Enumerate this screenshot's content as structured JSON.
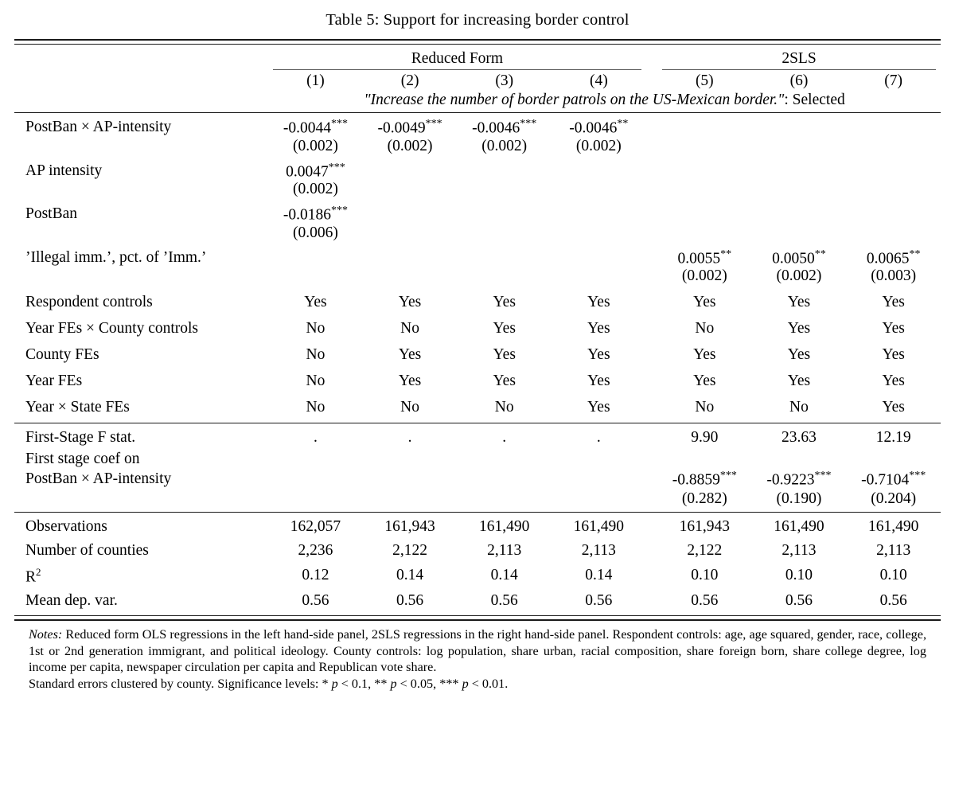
{
  "title": "Table 5: Support for increasing border control",
  "panels": [
    {
      "label": "Reduced Form",
      "span": 4
    },
    {
      "label": "2SLS",
      "span": 3
    }
  ],
  "column_numbers": [
    "(1)",
    "(2)",
    "(3)",
    "(4)",
    "(5)",
    "(6)",
    "(7)"
  ],
  "dep_var_line": {
    "italic_part": "\"Increase the number of border patrols on the US-Mexican border.\"",
    "roman_part": ": Selected"
  },
  "coef_blocks": [
    {
      "label": "PostBan × AP-intensity",
      "coefs": [
        "-0.0044",
        "-0.0049",
        "-0.0046",
        "-0.0046",
        "",
        "",
        ""
      ],
      "stars": [
        "***",
        "***",
        "***",
        "**",
        "",
        "",
        ""
      ],
      "ses": [
        "(0.002)",
        "(0.002)",
        "(0.002)",
        "(0.002)",
        "",
        "",
        ""
      ]
    },
    {
      "label": "AP intensity",
      "coefs": [
        "0.0047",
        "",
        "",
        "",
        "",
        "",
        ""
      ],
      "stars": [
        "***",
        "",
        "",
        "",
        "",
        "",
        ""
      ],
      "ses": [
        "(0.002)",
        "",
        "",
        "",
        "",
        "",
        ""
      ]
    },
    {
      "label": "PostBan",
      "coefs": [
        "-0.0186",
        "",
        "",
        "",
        "",
        "",
        ""
      ],
      "stars": [
        "***",
        "",
        "",
        "",
        "",
        "",
        ""
      ],
      "ses": [
        "(0.006)",
        "",
        "",
        "",
        "",
        "",
        ""
      ]
    },
    {
      "label": "’Illegal imm.’, pct. of ’Imm.’",
      "coefs": [
        "",
        "",
        "",
        "",
        "0.0055",
        "0.0050",
        "0.0065"
      ],
      "stars": [
        "",
        "",
        "",
        "",
        "**",
        "**",
        "**"
      ],
      "ses": [
        "",
        "",
        "",
        "",
        "(0.002)",
        "(0.002)",
        "(0.003)"
      ]
    }
  ],
  "yesno_rows": [
    {
      "label": "Respondent controls",
      "values": [
        "Yes",
        "Yes",
        "Yes",
        "Yes",
        "Yes",
        "Yes",
        "Yes"
      ]
    },
    {
      "label": "Year FEs × County controls",
      "values": [
        "No",
        "No",
        "Yes",
        "Yes",
        "No",
        "Yes",
        "Yes"
      ]
    },
    {
      "label": "County FEs",
      "values": [
        "No",
        "Yes",
        "Yes",
        "Yes",
        "Yes",
        "Yes",
        "Yes"
      ]
    },
    {
      "label": "Year FEs",
      "values": [
        "No",
        "Yes",
        "Yes",
        "Yes",
        "Yes",
        "Yes",
        "Yes"
      ]
    },
    {
      "label": "Year × State FEs",
      "values": [
        "No",
        "No",
        "No",
        "Yes",
        "No",
        "No",
        "Yes"
      ]
    }
  ],
  "firststage": {
    "fstat": {
      "label": "First-Stage F stat.",
      "values": [
        ".",
        ".",
        ".",
        ".",
        "9.90",
        "23.63",
        "12.19"
      ]
    },
    "coef_label_line1": "First stage coef on",
    "coef_label_line2": "PostBan × AP-intensity",
    "coefs": [
      "",
      "",
      "",
      "",
      "-0.8859",
      "-0.9223",
      "-0.7104"
    ],
    "stars": [
      "",
      "",
      "",
      "",
      "***",
      "***",
      "***"
    ],
    "ses": [
      "",
      "",
      "",
      "",
      "(0.282)",
      "(0.190)",
      "(0.204)"
    ]
  },
  "summary_rows": [
    {
      "label": "Observations",
      "sup": "",
      "values": [
        "162,057",
        "161,943",
        "161,490",
        "161,490",
        "161,943",
        "161,490",
        "161,490"
      ]
    },
    {
      "label": "Number of counties",
      "sup": "",
      "values": [
        "2,236",
        "2,122",
        "2,113",
        "2,113",
        "2,122",
        "2,113",
        "2,113"
      ]
    },
    {
      "label": "R",
      "sup": "2",
      "values": [
        "0.12",
        "0.14",
        "0.14",
        "0.14",
        "0.10",
        "0.10",
        "0.10"
      ]
    },
    {
      "label": "Mean dep. var.",
      "sup": "",
      "values": [
        "0.56",
        "0.56",
        "0.56",
        "0.56",
        "0.56",
        "0.56",
        "0.56"
      ]
    }
  ],
  "notes": {
    "lead": "Notes:",
    "body": "Reduced form OLS regressions in the left hand-side panel, 2SLS regressions in the right hand-side panel. Respondent controls: age, age squared, gender, race, college, 1st or 2nd generation immigrant, and political ideology. County controls: log population, share urban, racial composition, share foreign born, share college degree, log income per capita, newspaper circulation per capita and Republican vote share.",
    "signif_prefix": "Standard errors clustered by county. Significance levels: * ",
    "signif_p1": "p",
    "signif_p1_val": " < 0.1, ** ",
    "signif_p2": "p",
    "signif_p2_val": " < 0.05, *** ",
    "signif_p3": "p",
    "signif_p3_val": " < 0.01."
  }
}
